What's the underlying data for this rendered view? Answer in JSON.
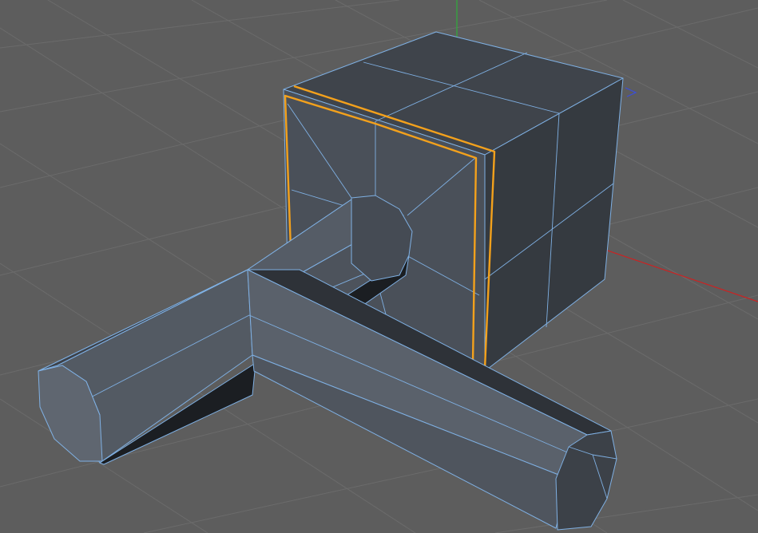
{
  "viewport": {
    "background_color": "#5d5d5d",
    "grid_color": "#6b6b6b",
    "wire_color": "#7fb0e3",
    "selection_color": "#f3a11c",
    "axis_colors": {
      "x": "#cc2222",
      "y": "#2fae3a",
      "z": "#3a4ee0"
    }
  },
  "scene": {
    "objects": [
      {
        "name": "cube",
        "type": "polygon-object",
        "color": "#454a53",
        "selected_edge_loop": true
      },
      {
        "name": "cylinder-stem",
        "type": "extruded-octagon",
        "color": "#4d535c"
      },
      {
        "name": "cylinder-crossbar",
        "type": "extruded-octagon",
        "color": "#59606a"
      }
    ],
    "selection_mode": "edge"
  }
}
